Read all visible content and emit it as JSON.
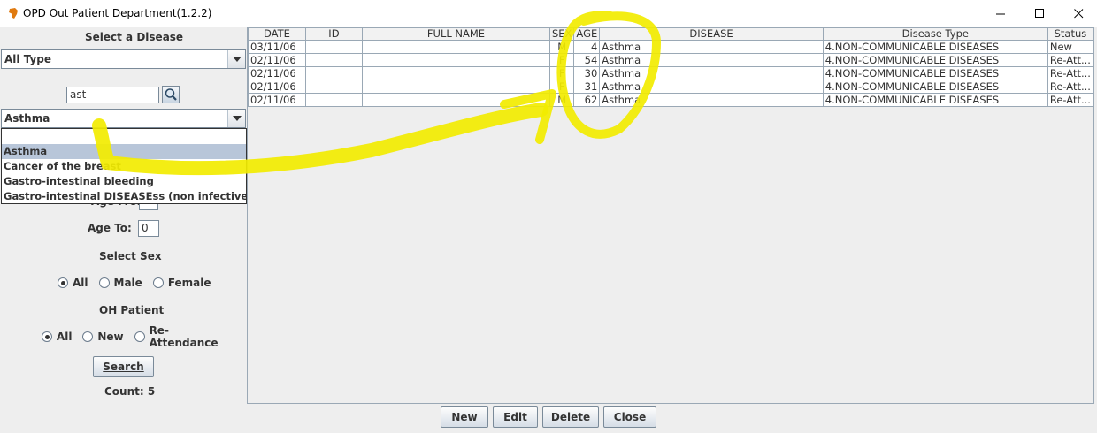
{
  "window": {
    "title": "OPD Out Patient Department(1.2.2)",
    "minimize_glyph": "—",
    "maximize_glyph": "☐",
    "close_glyph": "✕"
  },
  "filters": {
    "select_disease_label": "Select a Disease",
    "disease_type_value": "All Type",
    "search_text": "ast",
    "disease_value": "Asthma",
    "dropdown_items": [
      "Asthma",
      "Cancer of the breast",
      "Gastro-intestinal bleeding",
      "Gastro-intestinal DISEASEss (non infective)"
    ],
    "age_from_label": "Age From:",
    "age_to_label": "Age To:",
    "age_to_value": "0",
    "select_sex_label": "Select Sex",
    "sex_options": [
      "All",
      "Male",
      "Female"
    ],
    "oh_patient_label": "OH Patient",
    "oh_options": [
      "All",
      "New",
      "Re-Attendance"
    ],
    "search_button": "Search",
    "count_label": "Count: 5"
  },
  "table": {
    "columns": [
      "DATE",
      "ID",
      "FULL NAME",
      "SEX",
      "AGE",
      "DISEASE",
      "Disease Type",
      "Status"
    ],
    "rows": [
      [
        "03/11/06",
        "",
        "",
        "M",
        "4",
        "Asthma",
        "4.NON-COMMUNICABLE DISEASES",
        "New"
      ],
      [
        "02/11/06",
        "",
        "",
        "F",
        "54",
        "Asthma",
        "4.NON-COMMUNICABLE DISEASES",
        "Re-Att..."
      ],
      [
        "02/11/06",
        "",
        "",
        "F",
        "30",
        "Asthma",
        "4.NON-COMMUNICABLE DISEASES",
        "Re-Att..."
      ],
      [
        "02/11/06",
        "",
        "",
        "F",
        "31",
        "Asthma",
        "4.NON-COMMUNICABLE DISEASES",
        "Re-Att..."
      ],
      [
        "02/11/06",
        "",
        "",
        "M",
        "62",
        "Asthma",
        "4.NON-COMMUNICABLE DISEASES",
        "Re-Att..."
      ]
    ]
  },
  "buttons": {
    "new": "New",
    "edit": "Edit",
    "delete": "Delete",
    "close": "Close"
  },
  "colors": {
    "annotation_yellow": "#f2ec00",
    "panel_bg": "#eeeeee",
    "selection": "#b8c6d9"
  }
}
